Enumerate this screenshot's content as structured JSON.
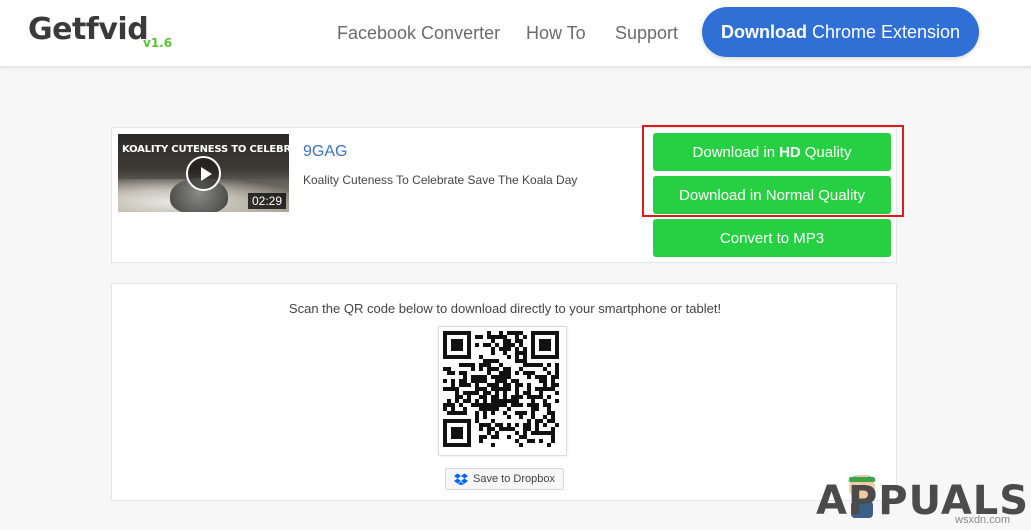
{
  "header": {
    "logo": "Getfvid",
    "version": "v1.6",
    "nav": [
      {
        "label": "Facebook Converter"
      },
      {
        "label": "How To"
      },
      {
        "label": "Support"
      }
    ],
    "extension_button": {
      "bold": "Download",
      "rest": "Chrome Extension"
    }
  },
  "video": {
    "thumbnail_title": "KOALITY CUTENESS TO CELEBRATE",
    "duration": "02:29",
    "channel": "9GAG",
    "title": "Koality Cuteness To Celebrate Save The Koala Day"
  },
  "buttons": {
    "hd": {
      "prefix": "Download in",
      "bold": "HD",
      "suffix": "Quality"
    },
    "normal": "Download in Normal Quality",
    "mp3": "Convert to MP3"
  },
  "qr": {
    "instruction": "Scan the QR code below to download directly to your smartphone or tablet!",
    "dropbox_label": "Save to Dropbox"
  },
  "watermark": {
    "text": "APPUALS",
    "site": "wsxdn.com"
  },
  "colors": {
    "green": "#27cf43",
    "blue": "#2f6fd6",
    "highlight": "#e01b1b"
  }
}
